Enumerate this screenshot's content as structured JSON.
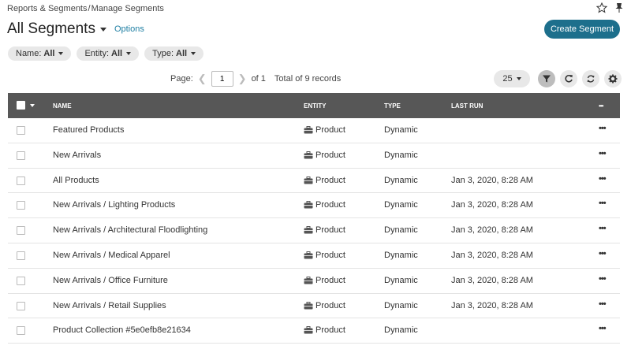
{
  "breadcrumb": {
    "parent": "Reports & Segments",
    "separator": "/",
    "current": "Manage Segments"
  },
  "icons": {
    "star": "star-icon",
    "pin": "pin-icon"
  },
  "header": {
    "title": "All Segments",
    "options_label": "Options",
    "create_label": "Create Segment"
  },
  "filters": [
    {
      "label": "Name:",
      "value": "All"
    },
    {
      "label": "Entity:",
      "value": "All"
    },
    {
      "label": "Type:",
      "value": "All"
    }
  ],
  "pager": {
    "page_label": "Page:",
    "current_page": "1",
    "of_label": "of 1",
    "total_label": "Total of 9 records"
  },
  "toolbar": {
    "per_page": "25"
  },
  "table": {
    "columns": {
      "name": "NAME",
      "entity": "ENTITY",
      "type": "TYPE",
      "last_run": "LAST RUN",
      "more": "•••"
    },
    "rows": [
      {
        "name": "Featured Products",
        "entity": "Product",
        "type": "Dynamic",
        "last_run": ""
      },
      {
        "name": "New Arrivals",
        "entity": "Product",
        "type": "Dynamic",
        "last_run": ""
      },
      {
        "name": "All Products",
        "entity": "Product",
        "type": "Dynamic",
        "last_run": "Jan 3, 2020, 8:28 AM"
      },
      {
        "name": "New Arrivals / Lighting Products",
        "entity": "Product",
        "type": "Dynamic",
        "last_run": "Jan 3, 2020, 8:28 AM"
      },
      {
        "name": "New Arrivals / Architectural Floodlighting",
        "entity": "Product",
        "type": "Dynamic",
        "last_run": "Jan 3, 2020, 8:28 AM"
      },
      {
        "name": "New Arrivals / Medical Apparel",
        "entity": "Product",
        "type": "Dynamic",
        "last_run": "Jan 3, 2020, 8:28 AM"
      },
      {
        "name": "New Arrivals / Office Furniture",
        "entity": "Product",
        "type": "Dynamic",
        "last_run": "Jan 3, 2020, 8:28 AM"
      },
      {
        "name": "New Arrivals / Retail Supplies",
        "entity": "Product",
        "type": "Dynamic",
        "last_run": "Jan 3, 2020, 8:28 AM"
      },
      {
        "name": "Product Collection #5e0efb8e21634",
        "entity": "Product",
        "type": "Dynamic",
        "last_run": ""
      }
    ],
    "row_more": "•••"
  },
  "colors": {
    "accent": "#1d6f8c",
    "link": "#1f7fa3",
    "header_bg": "#575757"
  }
}
